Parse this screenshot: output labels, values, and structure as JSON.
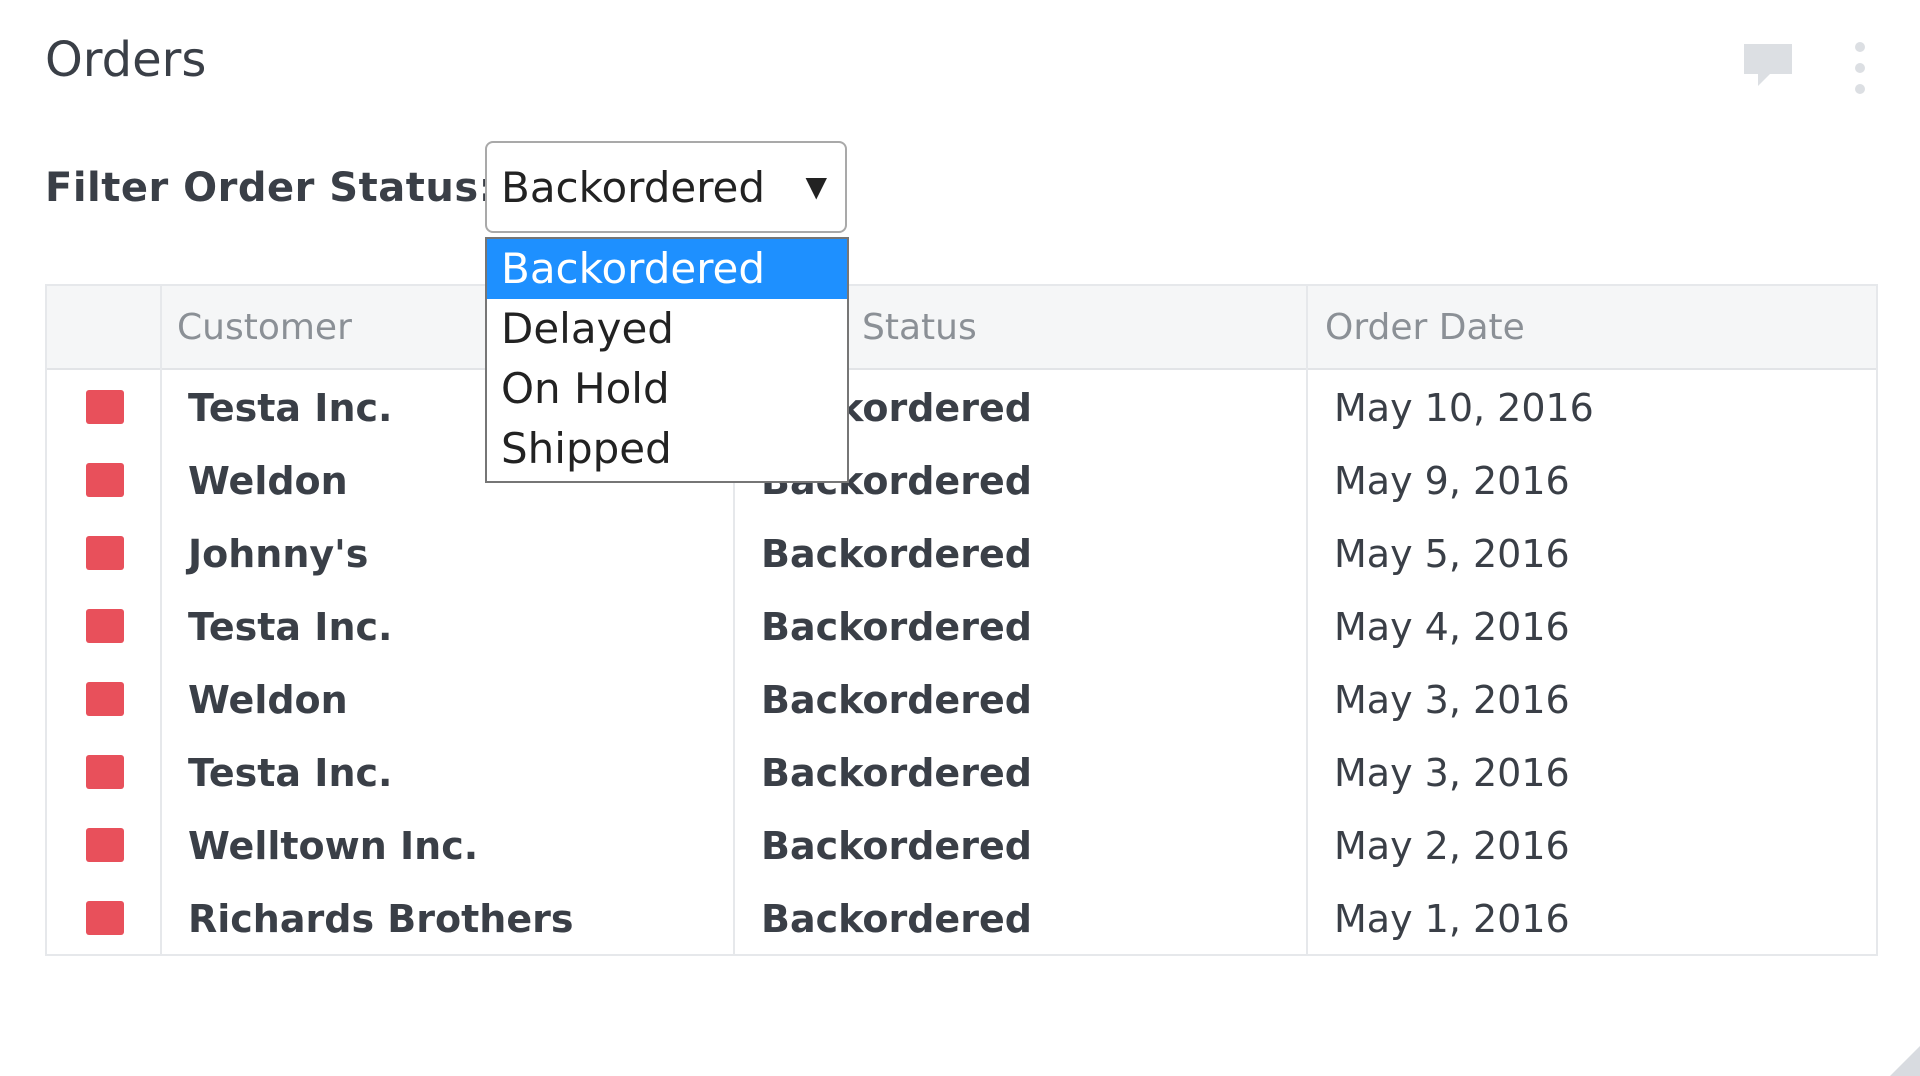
{
  "widget": {
    "title": "Orders",
    "icons": {
      "comment": "comment-icon",
      "menu": "more-vertical-icon"
    }
  },
  "filter": {
    "label": "Filter Order Status:",
    "selected": "Backordered",
    "arrow": "▼",
    "options": [
      "Backordered",
      "Delayed",
      "On Hold",
      "Shipped"
    ]
  },
  "table": {
    "headers": [
      "",
      "Customer",
      "Status",
      "Order Date"
    ],
    "status_color": "#e8505b",
    "rows": [
      {
        "customer": "Testa Inc.",
        "status": "Backordered",
        "date": "May 10, 2016"
      },
      {
        "customer": "Weldon",
        "status": "Backordered",
        "date": "May 9, 2016"
      },
      {
        "customer": "Johnny's",
        "status": "Backordered",
        "date": "May 5, 2016"
      },
      {
        "customer": "Testa Inc.",
        "status": "Backordered",
        "date": "May 4, 2016"
      },
      {
        "customer": "Weldon",
        "status": "Backordered",
        "date": "May 3, 2016"
      },
      {
        "customer": "Testa Inc.",
        "status": "Backordered",
        "date": "May 3, 2016"
      },
      {
        "customer": "Welltown Inc.",
        "status": "Backordered",
        "date": "May 2, 2016"
      },
      {
        "customer": "Richards Brothers",
        "status": "Backordered",
        "date": "May 1, 2016"
      }
    ]
  },
  "colors": {
    "accent": "#1e90ff",
    "text": "#3a3f47",
    "header_text": "#8b9096"
  }
}
